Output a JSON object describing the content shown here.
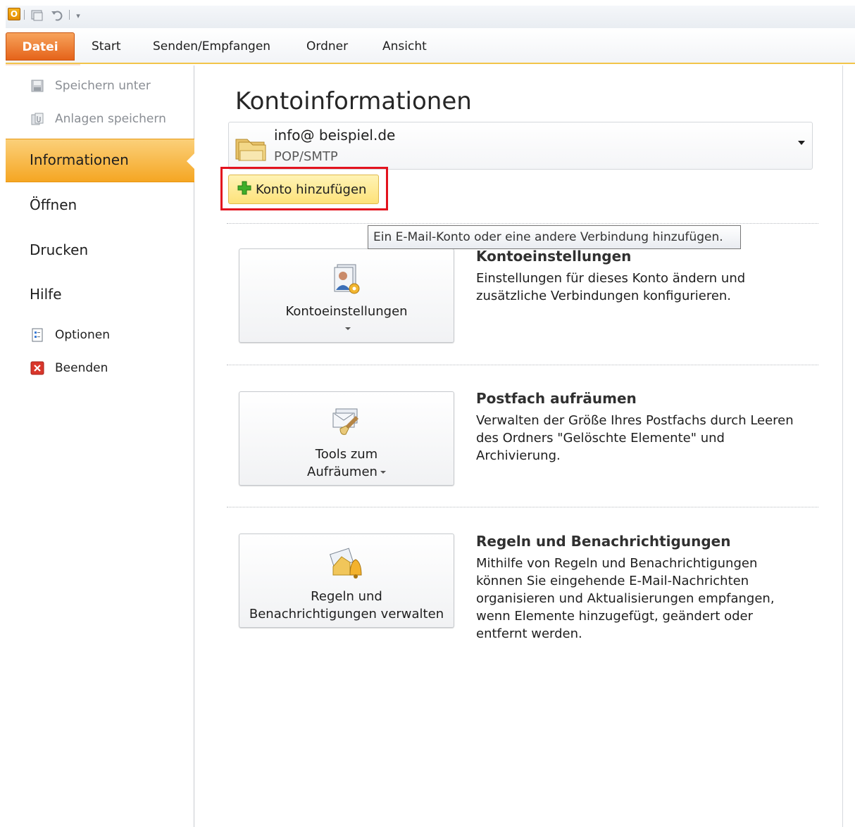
{
  "ribbon": {
    "tabs": [
      "Datei",
      "Start",
      "Senden/Empfangen",
      "Ordner",
      "Ansicht"
    ],
    "active_tab": "Datei"
  },
  "backstage_nav": {
    "commands_top": [
      {
        "label": "Speichern unter",
        "icon": "save-as-icon",
        "disabled": true
      },
      {
        "label": "Anlagen speichern",
        "icon": "save-attachments-icon",
        "disabled": true
      }
    ],
    "selected": "Informationen",
    "items": [
      "Öffnen",
      "Drucken",
      "Hilfe"
    ],
    "commands_bottom": [
      {
        "label": "Optionen",
        "icon": "options-icon"
      },
      {
        "label": "Beenden",
        "icon": "exit-icon"
      }
    ]
  },
  "main": {
    "title": "Kontoinformationen",
    "account": {
      "email": "info@ beispiel.de",
      "type": "POP/SMTP"
    },
    "add_account_label": "Konto hinzufügen",
    "tooltip": "Ein E-Mail-Konto oder eine andere Verbindung hinzufügen.",
    "sections": [
      {
        "button_label": "Kontoeinstellungen",
        "heading": "Kontoeinstellungen",
        "description": "Einstellungen für dieses Konto ändern und zusätzliche Verbindungen konfigurieren."
      },
      {
        "button_label_line1": "Tools zum",
        "button_label_line2": "Aufräumen",
        "heading": "Postfach aufräumen",
        "description": "Verwalten der Größe Ihres Postfachs durch Leeren des Ordners \"Gelöschte Elemente\" und Archivierung."
      },
      {
        "button_label_line1": "Regeln und",
        "button_label_line2": "Benachrichtigungen verwalten",
        "heading": "Regeln und Benachrichtigungen",
        "description": "Mithilfe von Regeln und Benachrichtigungen können Sie eingehende E-Mail-Nachrichten organisieren und Aktualisierungen empfangen, wenn Elemente hinzugefügt, geändert oder entfernt werden."
      }
    ]
  },
  "colors": {
    "accent_orange": "#f5a623",
    "datei_tab": "#e5631a",
    "highlight_red": "#e3131e",
    "add_button": "#fde27a"
  }
}
